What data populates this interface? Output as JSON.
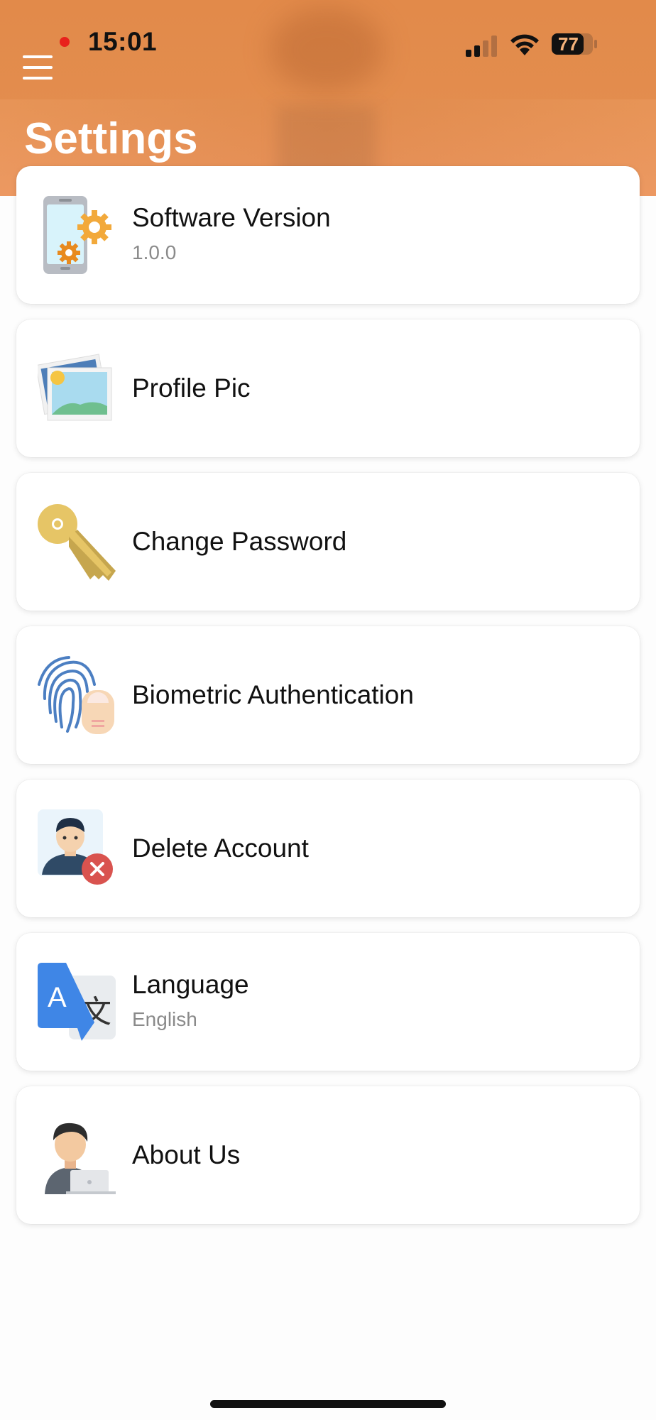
{
  "status_bar": {
    "time": "15:01",
    "battery": "77"
  },
  "header": {
    "title": "Settings"
  },
  "settings": {
    "items": [
      {
        "label": "Software Version",
        "sub": "1.0.0",
        "icon": "phone-settings-icon"
      },
      {
        "label": "Profile Pic",
        "sub": "",
        "icon": "photo-icon"
      },
      {
        "label": "Change Password",
        "sub": "",
        "icon": "key-icon"
      },
      {
        "label": "Biometric Authentication",
        "sub": "",
        "icon": "fingerprint-icon"
      },
      {
        "label": "Delete Account",
        "sub": "",
        "icon": "delete-user-icon"
      },
      {
        "label": "Language",
        "sub": "English",
        "icon": "translate-icon"
      },
      {
        "label": "About Us",
        "sub": "",
        "icon": "person-laptop-icon"
      }
    ]
  },
  "colors": {
    "header": "#e38d4e",
    "card": "#ffffff",
    "subtext": "#8a8a8a"
  }
}
